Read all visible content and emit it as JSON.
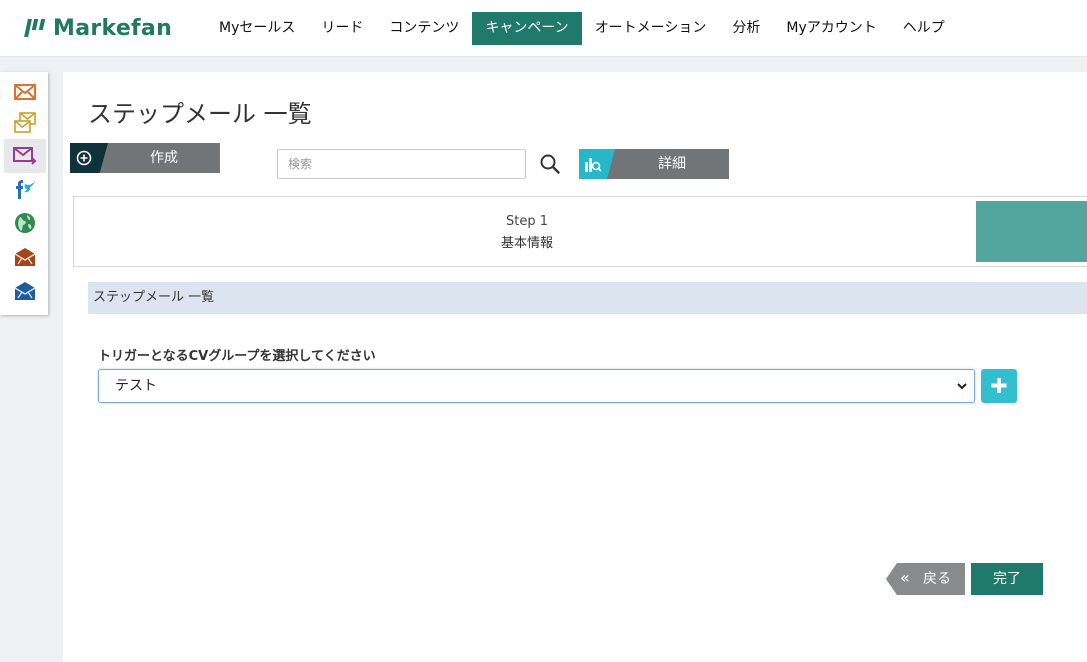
{
  "header": {
    "logo_text": "Markefan",
    "nav": [
      {
        "label": "Myセールス"
      },
      {
        "label": "リード"
      },
      {
        "label": "コンテンツ"
      },
      {
        "label": "キャンペーン",
        "active": true
      },
      {
        "label": "オートメーション"
      },
      {
        "label": "分析"
      },
      {
        "label": "Myアカウント"
      },
      {
        "label": "ヘルプ"
      }
    ]
  },
  "sidebar": {
    "icons": [
      "mail-icon",
      "multi-mail-icon",
      "step-mail-icon",
      "social-icon",
      "globe-icon",
      "mail-campaign-icon",
      "mail-blue-icon"
    ],
    "active_index": 2
  },
  "page": {
    "title": "ステップメール 一覧",
    "create_label": "作成",
    "search_placeholder": "検索",
    "detail_label": "詳細"
  },
  "steps": {
    "step_number": "Step 1",
    "step_name": "基本情報"
  },
  "section": {
    "title": "ステップメール 一覧"
  },
  "form": {
    "trigger_label": "トリガーとなるCVグループを選択してください",
    "trigger_value": "テスト"
  },
  "footer": {
    "back_label": "戻る",
    "done_label": "完了"
  },
  "colors": {
    "brand": "#1f7a5e",
    "nav_active": "#1f7a6c",
    "step_accent": "#52a69e",
    "add_button": "#34bfd0",
    "section_bg": "#dce4ef"
  }
}
